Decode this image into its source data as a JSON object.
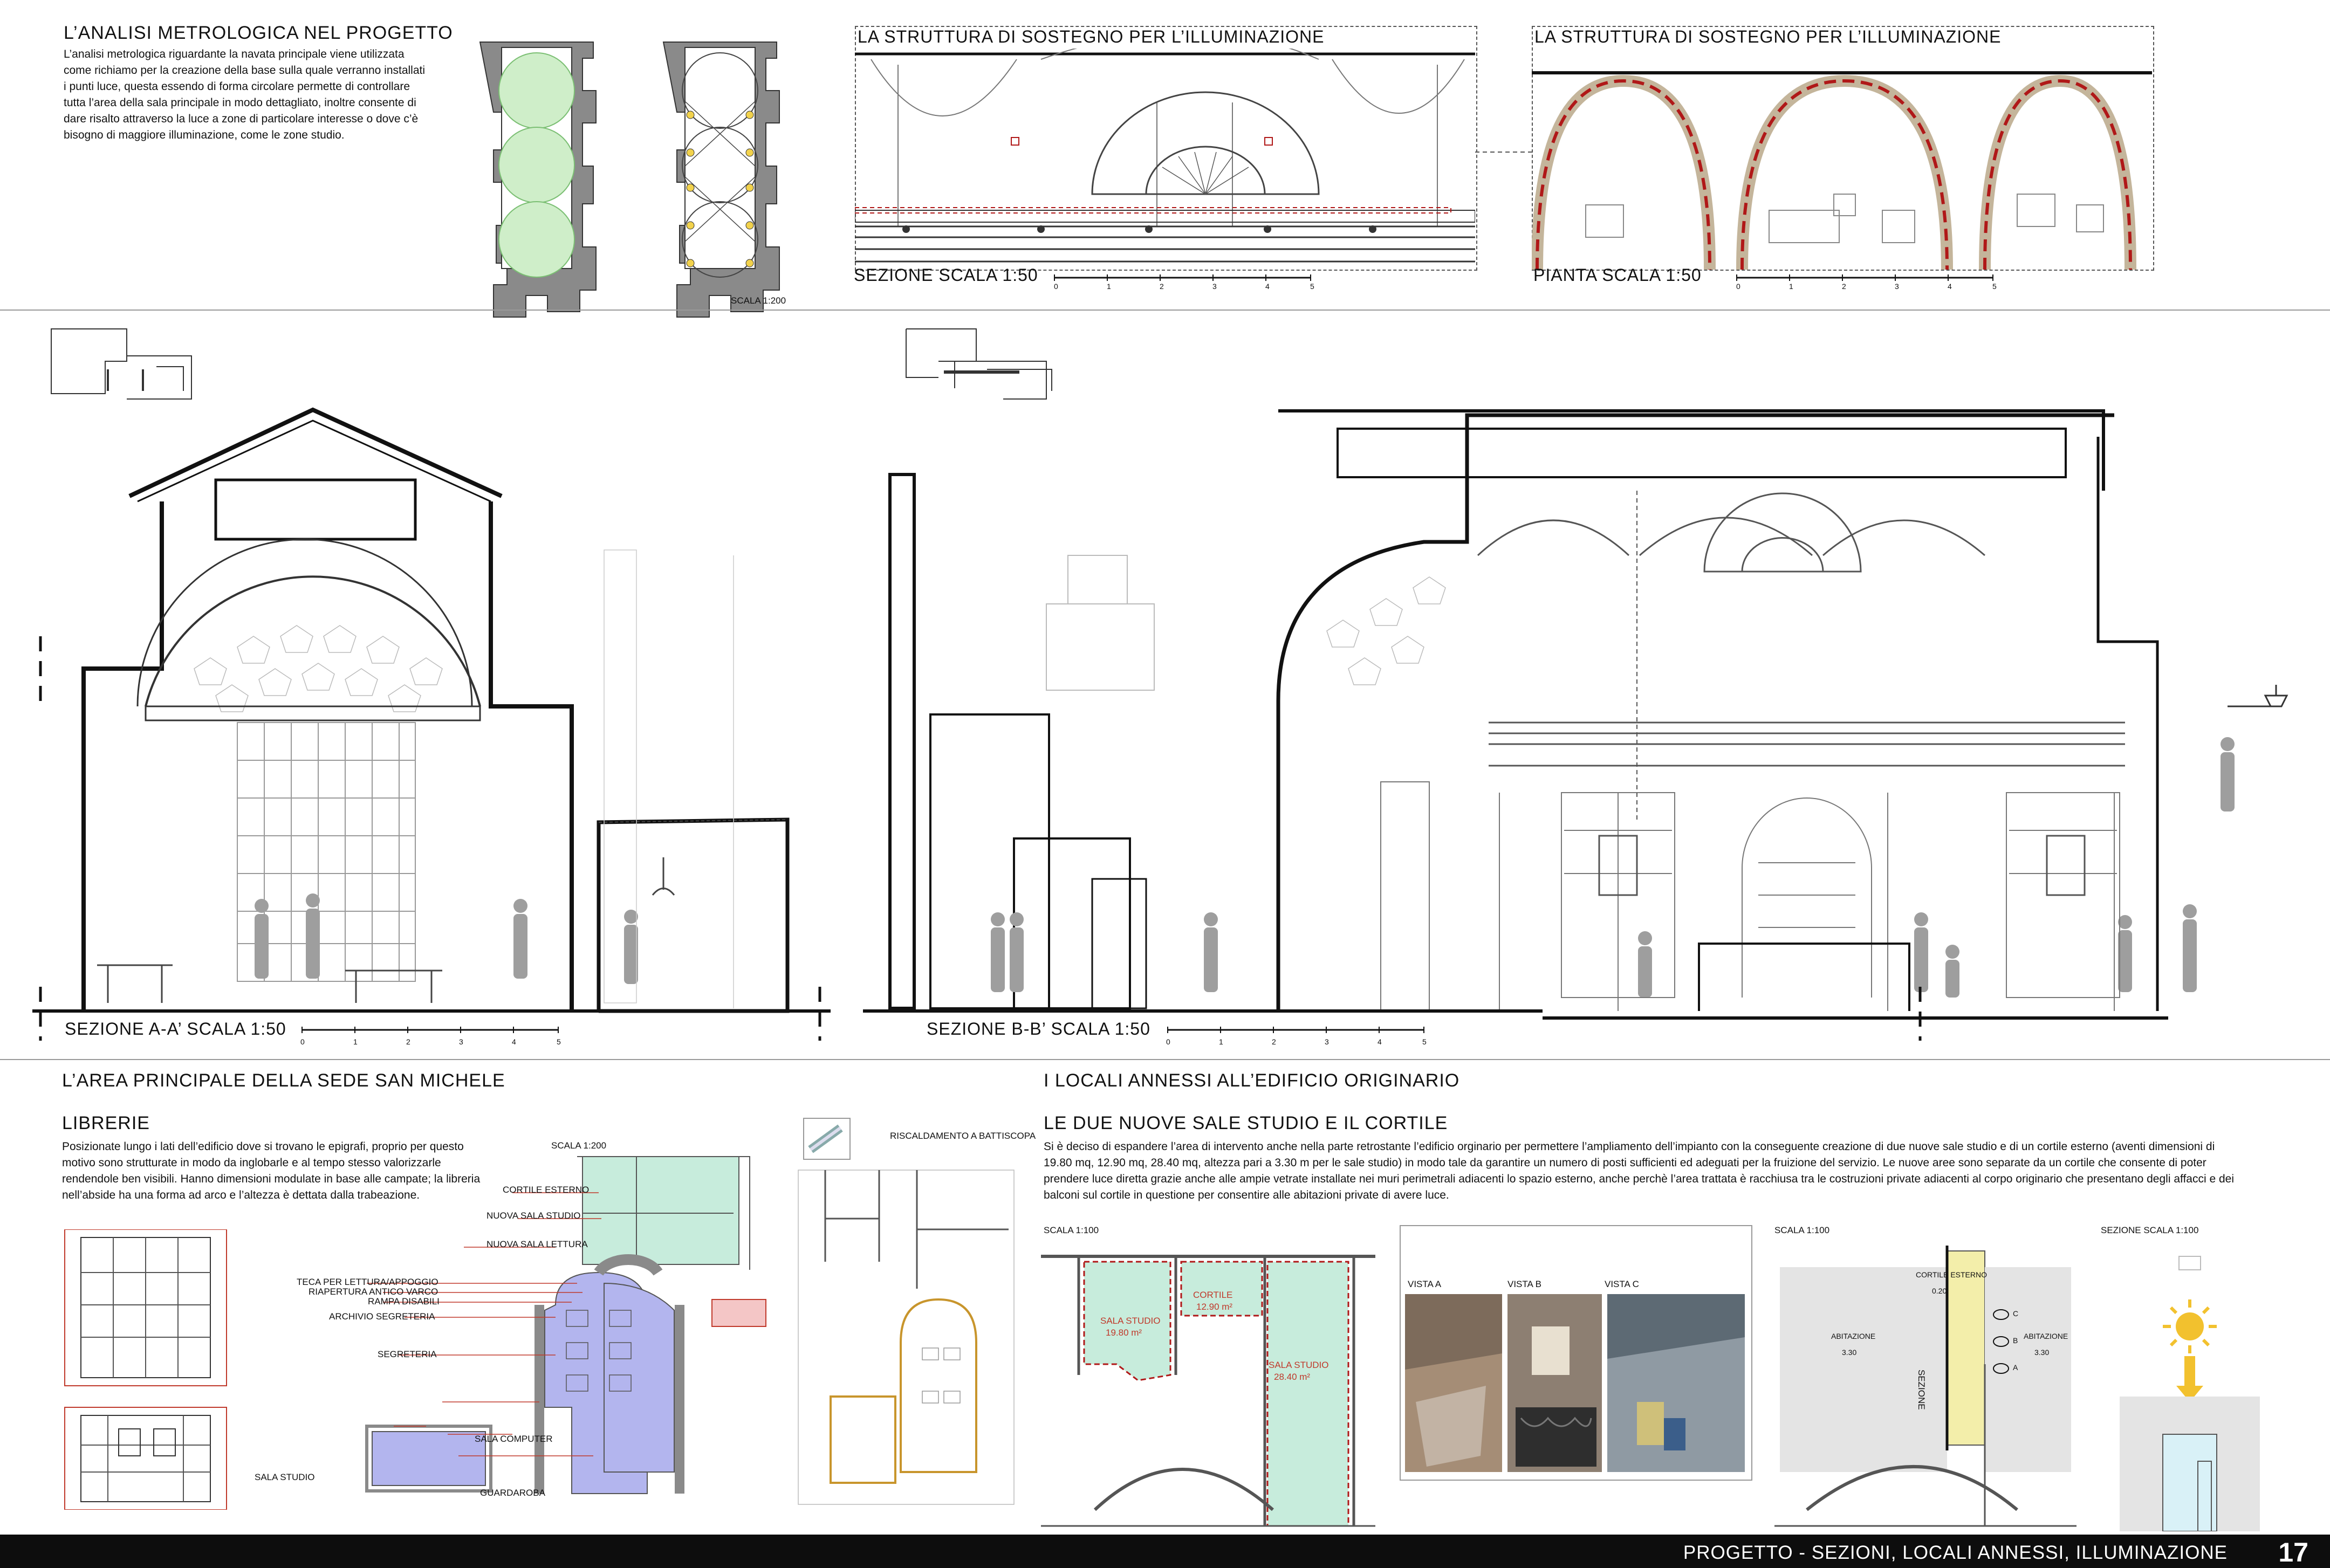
{
  "header": {
    "title": "L’ANALISI METROLOGICA NEL PROGETTO",
    "body": "L’analisi metrologica riguardante la navata principale viene utilizzata come richiamo per la creazione della base sulla quale verranno installati i punti luce, questa essendo di forma circolare permette di controllare tutta l’area della sala principale in modo dettagliato, inoltre consente di dare risalto attraverso la luce a zone di particolare interesse o dove c’è bisogno di maggiore illuminazione, come le zone studio.",
    "scale_label": "SCALA 1:200"
  },
  "lighting": {
    "section_title": "LA STRUTTURA DI SOSTEGNO PER L’ILLUMINAZIONE",
    "section_scale": "SEZIONE SCALA 1:50",
    "plan_title": "LA STRUTTURA DI SOSTEGNO PER L’ILLUMINAZIONE",
    "plan_scale": "PIANTA SCALA 1:50",
    "ticks": [
      "0",
      "1",
      "2",
      "3",
      "4",
      "5"
    ]
  },
  "sections": {
    "a_label": "SEZIONE A-A’ SCALA 1:50",
    "b_label": "SEZIONE B-B’ SCALA 1:50",
    "ticks": [
      "0",
      "1",
      "2",
      "3",
      "4",
      "5"
    ]
  },
  "main_area": {
    "title": "L’AREA PRINCIPALE DELLA SEDE SAN MICHELE",
    "subtitle": "LIBRERIE",
    "body": "Posizionate lungo i lati dell’edificio dove si trovano le epigrafi, proprio per questo motivo sono strutturate in modo da inglobarle e al tempo stesso valorizzarle rendendole ben visibili. Hanno dimensioni modulate in base alle campate; la libreria nell’abside ha una forma ad arco e l’altezza è dettata dalla trabeazione.",
    "plan_scale": "SCALA 1:200",
    "heating_label": "RISCALDAMENTO A BATTISCOPA",
    "legend": [
      "CORTILE ESTERNO",
      "NUOVA SALA STUDIO",
      "NUOVA SALA LETTURA",
      "TECA PER LETTURA/APPOGGIO",
      "RIAPERTURA ANTICO VARCO",
      "RAMPA DISABILI",
      "ARCHIVIO SEGRETERIA",
      "SEGRETERIA",
      "SALA COMPUTER",
      "SALA STUDIO",
      "GUARDAROBA"
    ]
  },
  "annexes": {
    "title": "I LOCALI ANNESSI ALL’EDIFICIO ORIGINARIO",
    "subtitle": "LE DUE NUOVE SALE STUDIO E IL CORTILE",
    "body": "Si è deciso di espandere l’area di intervento anche nella parte retrostante l’edificio orginario per permettere l’ampliamento dell’impianto con la conseguente creazione di due nuove sale studio e di un cortile esterno (aventi dimensioni di 19.80 mq, 12.90 mq, 28.40 mq, altezza pari a 3.30 m per le sale studio) in modo tale da garantire un numero di posti sufficienti ed adeguati per la fruizione del servizio. Le nuove aree sono separate da un cortile che consente di poter prendere luce diretta grazie anche alle ampie vetrate installate nei muri perimetrali adiacenti lo spazio esterno, anche perchè l’area trattata è racchiusa tra le costruzioni private adiacenti al corpo originario che presentano degli affacci e dei balconi sul cortile in questione per consentire alle abitazioni private di avere luce.",
    "plan_scale": "SCALA 1:100",
    "rooms": [
      {
        "name": "SALA STUDIO",
        "area": "19.80 m²"
      },
      {
        "name": "CORTILE",
        "area": "12.90 m²"
      },
      {
        "name": "SALA STUDIO",
        "area": "28.40 m²"
      }
    ],
    "views": [
      "VISTA A",
      "VISTA B",
      "VISTA C"
    ],
    "scheme_scale": "SCALA 1:100",
    "scheme_labels": {
      "left": "ABITAZIONE",
      "left_h": "3.30",
      "court": "CORTILE ESTERNO",
      "court_h": "0.20",
      "section": "SEZIONE",
      "right": "ABITAZIONE",
      "right_h": "3.30",
      "views": [
        "C",
        "B",
        "A"
      ]
    },
    "section_scale": "SEZIONE SCALA 1:100"
  },
  "footer": {
    "title": "PROGETTO - SEZIONI, LOCALI ANNESSI, ILLUMINAZIONE",
    "page": "17"
  },
  "colors": {
    "wall": "#8a8a8a",
    "green_fill": "#cfeec9",
    "blue_fill": "#b3b5ee",
    "mint_fill": "#c7ecdc",
    "yellow_fill": "#f3eeaa",
    "red_dash": "#b01818",
    "red_label": "#c0392b",
    "beam": "#c4b59b"
  }
}
